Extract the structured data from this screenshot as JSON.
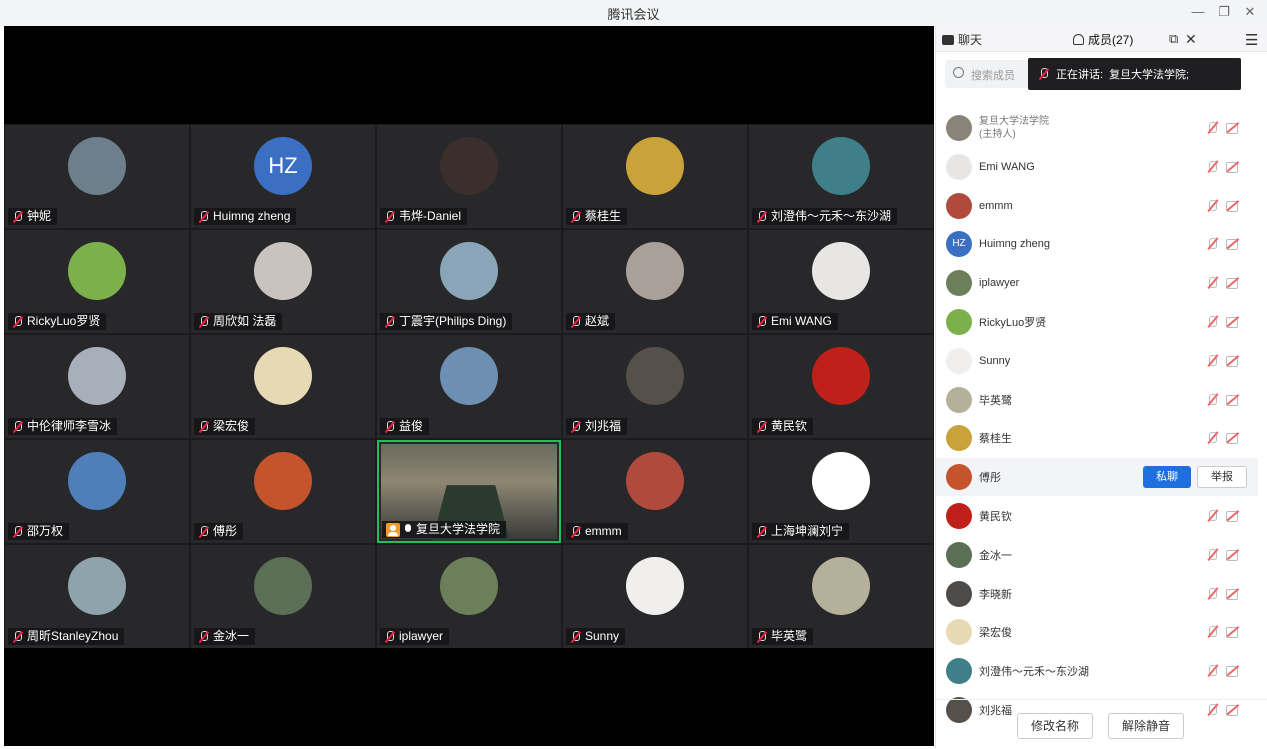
{
  "window": {
    "title": "腾讯会议",
    "min_glyph": "—",
    "restore_glyph": "❐",
    "close_glyph": "✕"
  },
  "tiles": [
    {
      "name": "钟妮",
      "avatar_color": "#6d7f8a"
    },
    {
      "name": "Huimng zheng",
      "avatar_text": "HZ",
      "avatar_color": "#3a6fc4"
    },
    {
      "name": "韦烨-Daniel",
      "avatar_color": "#3a2f2a"
    },
    {
      "name": "蔡桂生",
      "avatar_color": "#c9a23a"
    },
    {
      "name": "刘澄伟～元禾～东沙湖",
      "avatar_color": "#3f7f8a"
    },
    {
      "name": "RickyLuo罗贤",
      "avatar_color": "#7bb04a"
    },
    {
      "name": "周欣如 法磊",
      "avatar_color": "#c9c3be"
    },
    {
      "name": "丁震宇(Philips Ding)",
      "avatar_color": "#8aa4b8"
    },
    {
      "name": "赵斌",
      "avatar_color": "#a9a09a"
    },
    {
      "name": "Emi WANG",
      "avatar_color": "#e8e6e4"
    },
    {
      "name": "中伦律师李雪冰",
      "avatar_color": "#a7b0ba"
    },
    {
      "name": "梁宏俊",
      "avatar_color": "#e7d9b4"
    },
    {
      "name": "益俊",
      "avatar_color": "#6d8fb2"
    },
    {
      "name": "刘兆福",
      "avatar_color": "#55504a"
    },
    {
      "name": "黄民钦",
      "avatar_color": "#c0201a"
    },
    {
      "name": "邵万权",
      "avatar_color": "#4f7fb8"
    },
    {
      "name": "傅彤",
      "avatar_color": "#c5542c"
    },
    {
      "name": "复旦大学法学院",
      "active": true
    },
    {
      "name": "emmm",
      "avatar_color": "#b04a3c"
    },
    {
      "name": "上海坤澜刘宁",
      "avatar_color": "#ffffff"
    },
    {
      "name": "周昕StanleyZhou",
      "avatar_color": "#8fa3ad"
    },
    {
      "name": "金冰一",
      "avatar_color": "#5a6f55"
    },
    {
      "name": "iplawyer",
      "avatar_color": "#6b7f5a"
    },
    {
      "name": "Sunny",
      "avatar_color": "#f1efee"
    },
    {
      "name": "毕英鹭",
      "avatar_color": "#b4b09a"
    }
  ],
  "panel": {
    "tab_chat": "聊天",
    "tab_members": "成员(27)",
    "search_placeholder": "搜索成员",
    "speaking_label": "正在讲话:",
    "speaking_name": "复旦大学法学院;",
    "members": [
      {
        "name": "复旦大学法学院\n(主持人)",
        "avatar_color": "#8a8478",
        "host": true
      },
      {
        "name": "Emi WANG",
        "avatar_color": "#e8e6e4"
      },
      {
        "name": "emmm",
        "avatar_color": "#b04a3c"
      },
      {
        "name": "Huimng zheng",
        "avatar_text": "HZ",
        "avatar_color": "#3a6fc4"
      },
      {
        "name": "iplawyer",
        "avatar_color": "#6b7f5a"
      },
      {
        "name": "RickyLuo罗贤",
        "avatar_color": "#7bb04a"
      },
      {
        "name": "Sunny",
        "avatar_color": "#f1efee"
      },
      {
        "name": "毕英鹭",
        "avatar_color": "#b4b09a"
      },
      {
        "name": "蔡桂生",
        "avatar_color": "#c9a23a"
      },
      {
        "name": "傅彤",
        "avatar_color": "#c5542c",
        "hover": true
      },
      {
        "name": "黄民钦",
        "avatar_color": "#c0201a"
      },
      {
        "name": "金冰一",
        "avatar_color": "#5a6f55"
      },
      {
        "name": "李晓新",
        "avatar_color": "#4e4a47"
      },
      {
        "name": "梁宏俊",
        "avatar_color": "#e7d9b4"
      },
      {
        "name": "刘澄伟～元禾～东沙湖",
        "avatar_color": "#3f7f8a"
      },
      {
        "name": "刘兆福",
        "avatar_color": "#55504a"
      }
    ],
    "private_chat": "私聊",
    "report": "举报",
    "rename": "修改名称",
    "unmute": "解除静音"
  }
}
